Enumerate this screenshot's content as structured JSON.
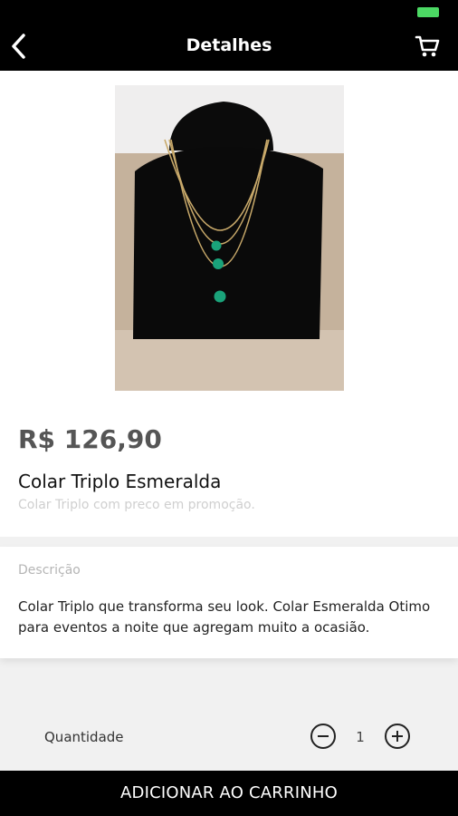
{
  "header": {
    "title": "Detalhes",
    "back_icon": "chevron-left-icon",
    "cart_icon": "cart-icon"
  },
  "product": {
    "price": "R$ 126,90",
    "name": "Colar Triplo Esmeralda",
    "subtitle": "Colar Triplo com preco em promoção."
  },
  "description": {
    "label": "Descrição",
    "text": "Colar Triplo que transforma seu look. Colar Esmeralda Otimo para eventos a noite que agregam muito a ocasião."
  },
  "quantity": {
    "label": "Quantidade",
    "value": "1"
  },
  "actions": {
    "add_to_cart": "ADICIONAR AO CARRINHO"
  },
  "colors": {
    "header_bg": "#000000",
    "accent_battery": "#4cd964",
    "emerald": "#1aa37a"
  }
}
